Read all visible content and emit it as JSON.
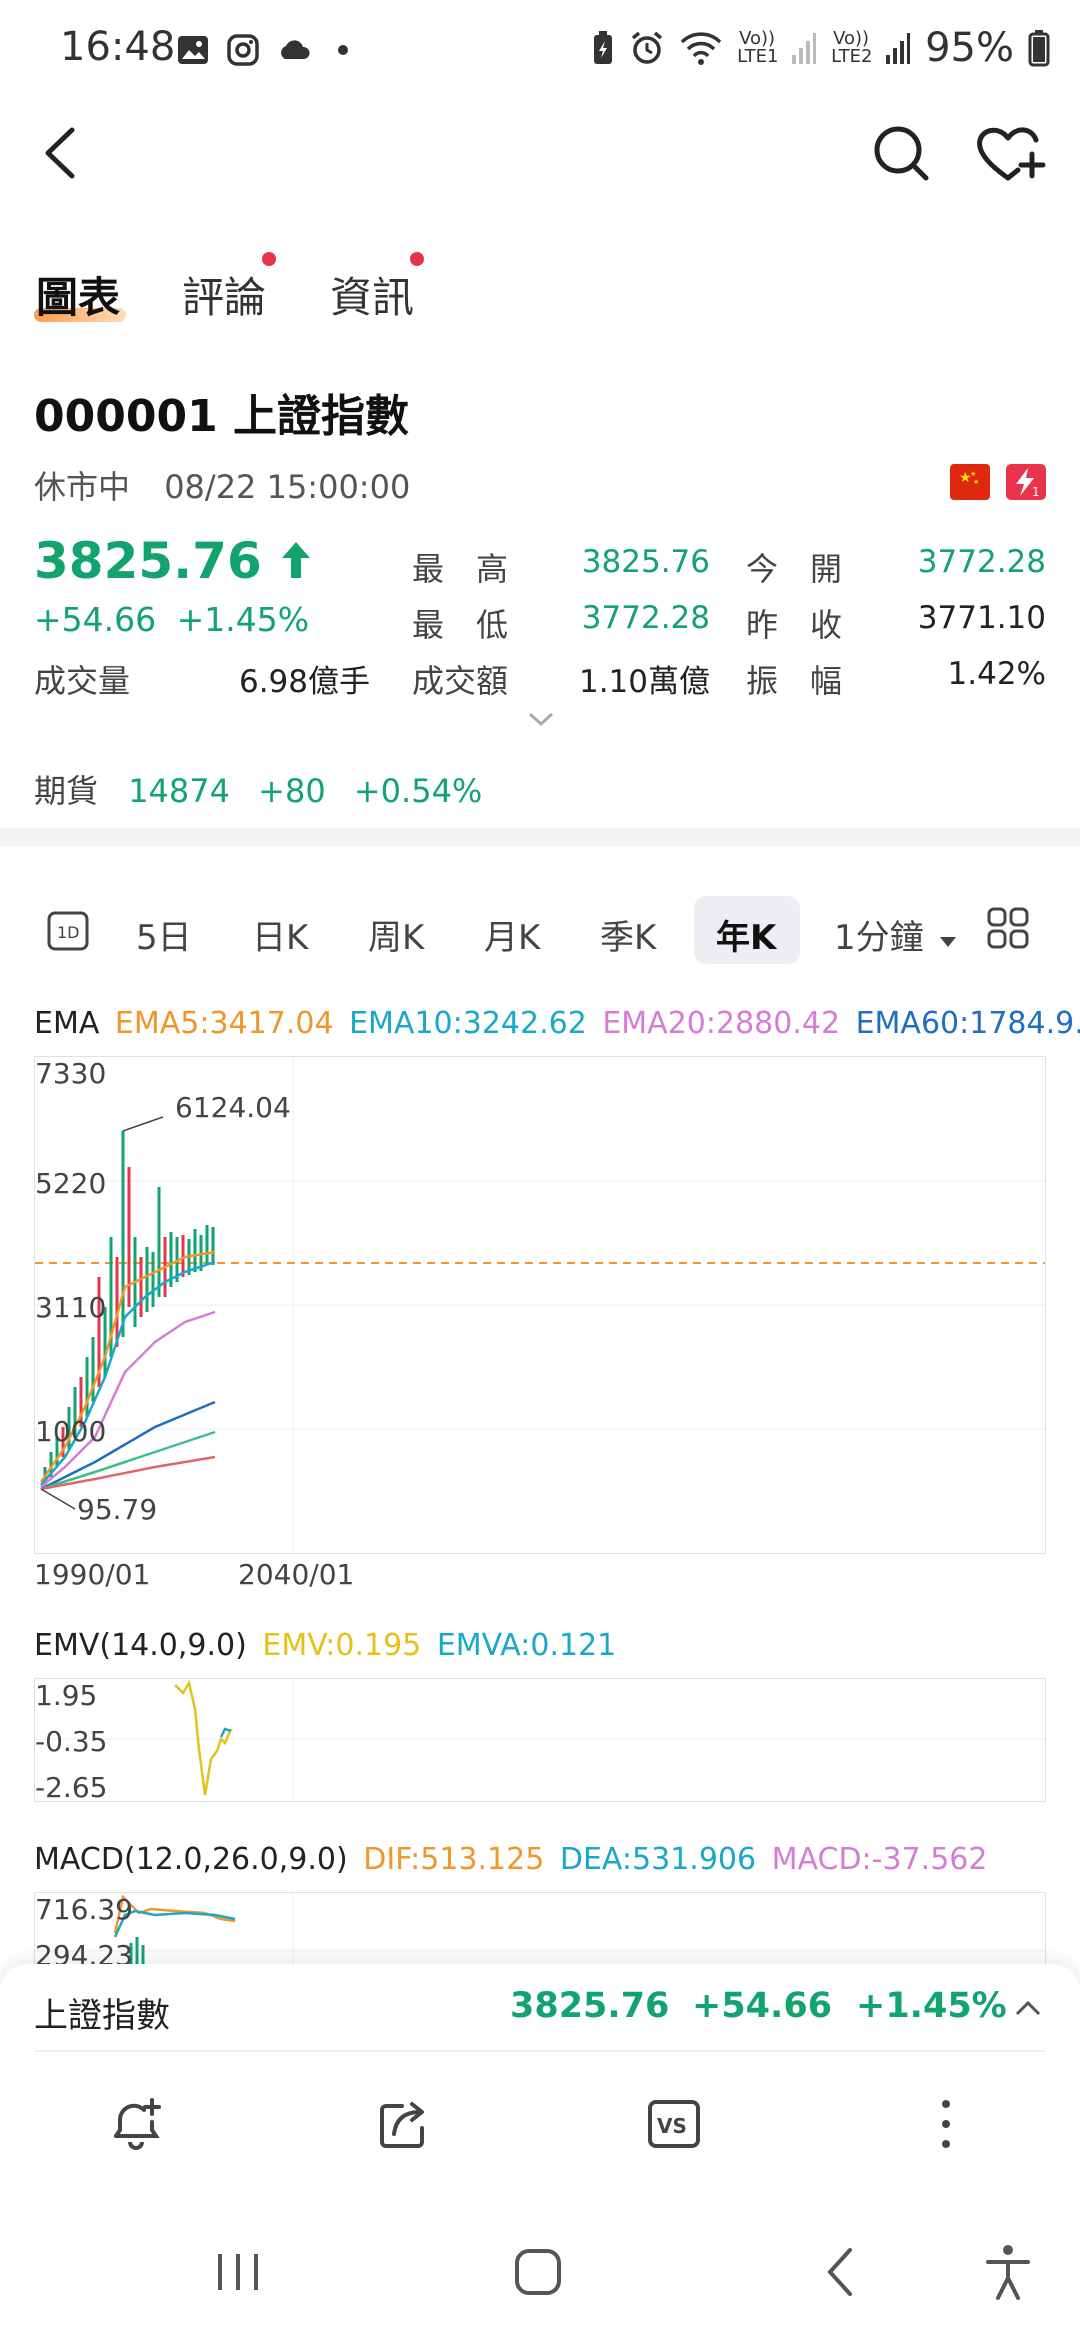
{
  "status_bar": {
    "time": "16:48",
    "left_icons": [
      "image-icon",
      "instagram-icon",
      "cloud-icon",
      "dot-icon"
    ],
    "volte1": "Vo)) LTE1",
    "volte2": "Vo)) LTE2",
    "battery": "95%"
  },
  "tabs": [
    {
      "label": "圖表",
      "active": true
    },
    {
      "label": "評論",
      "badge": true
    },
    {
      "label": "資訊",
      "badge": true
    }
  ],
  "stock": {
    "code_name": "000001 上證指數",
    "market_status": "休市中",
    "datetime": "08/22 15:00:00",
    "price": "3825.76",
    "change": "+54.66",
    "change_pct": "+1.45%",
    "volume_label": "成交量",
    "volume_value": "6.98億手",
    "high_label": "最　高",
    "high_value": "3825.76",
    "low_label": "最　低",
    "low_value": "3772.28",
    "turnover_label": "成交額",
    "turnover_value": "1.10萬億",
    "open_label": "今　開",
    "open_value": "3772.28",
    "prev_close_label": "昨　收",
    "prev_close_value": "3771.10",
    "amplitude_label": "振　幅",
    "amplitude_value": "1.42%",
    "up_color": "#12a36f"
  },
  "futures": {
    "label": "期貨",
    "value": "14874",
    "change": "+80",
    "change_pct": "+0.54%"
  },
  "timeframes": [
    "5日",
    "日K",
    "周K",
    "月K",
    "季K",
    "年K",
    "1分鐘"
  ],
  "timeframe_active": "年K",
  "ema": {
    "title": "EMA",
    "ema5": "EMA5:3417.04",
    "ema10": "EMA10:3242.62",
    "ema20": "EMA20:2880.42",
    "ema60": "EMA60:1784.9…",
    "colors": {
      "ema5": "#f0962a",
      "ema10": "#1aa8c9",
      "ema20": "#d67bd6",
      "ema60": "#1f6fc0"
    }
  },
  "main_chart": {
    "y_labels": [
      "7330",
      "5220",
      "3110",
      "1000"
    ],
    "max_label": "6124.04",
    "min_label": "95.79",
    "x_labels": [
      "1990/01",
      "2040/01"
    ]
  },
  "emv": {
    "title": "EMV(14.0,9.0)",
    "emv": "EMV:0.195",
    "emva": "EMVA:0.121",
    "y_labels": [
      "1.95",
      "-0.35",
      "-2.65"
    ]
  },
  "macd": {
    "title": "MACD(12.0,26.0,9.0)",
    "dif": "DIF:513.125",
    "dea": "DEA:531.906",
    "macd": "MACD:-37.562",
    "y_labels": [
      "716.39",
      "294.23"
    ]
  },
  "bottom_sheet": {
    "name": "上證指數",
    "price": "3825.76",
    "change": "+54.66",
    "change_pct": "+1.45%",
    "actions": [
      "bell-plus-icon",
      "share-icon",
      "vs-icon",
      "more-icon"
    ]
  }
}
